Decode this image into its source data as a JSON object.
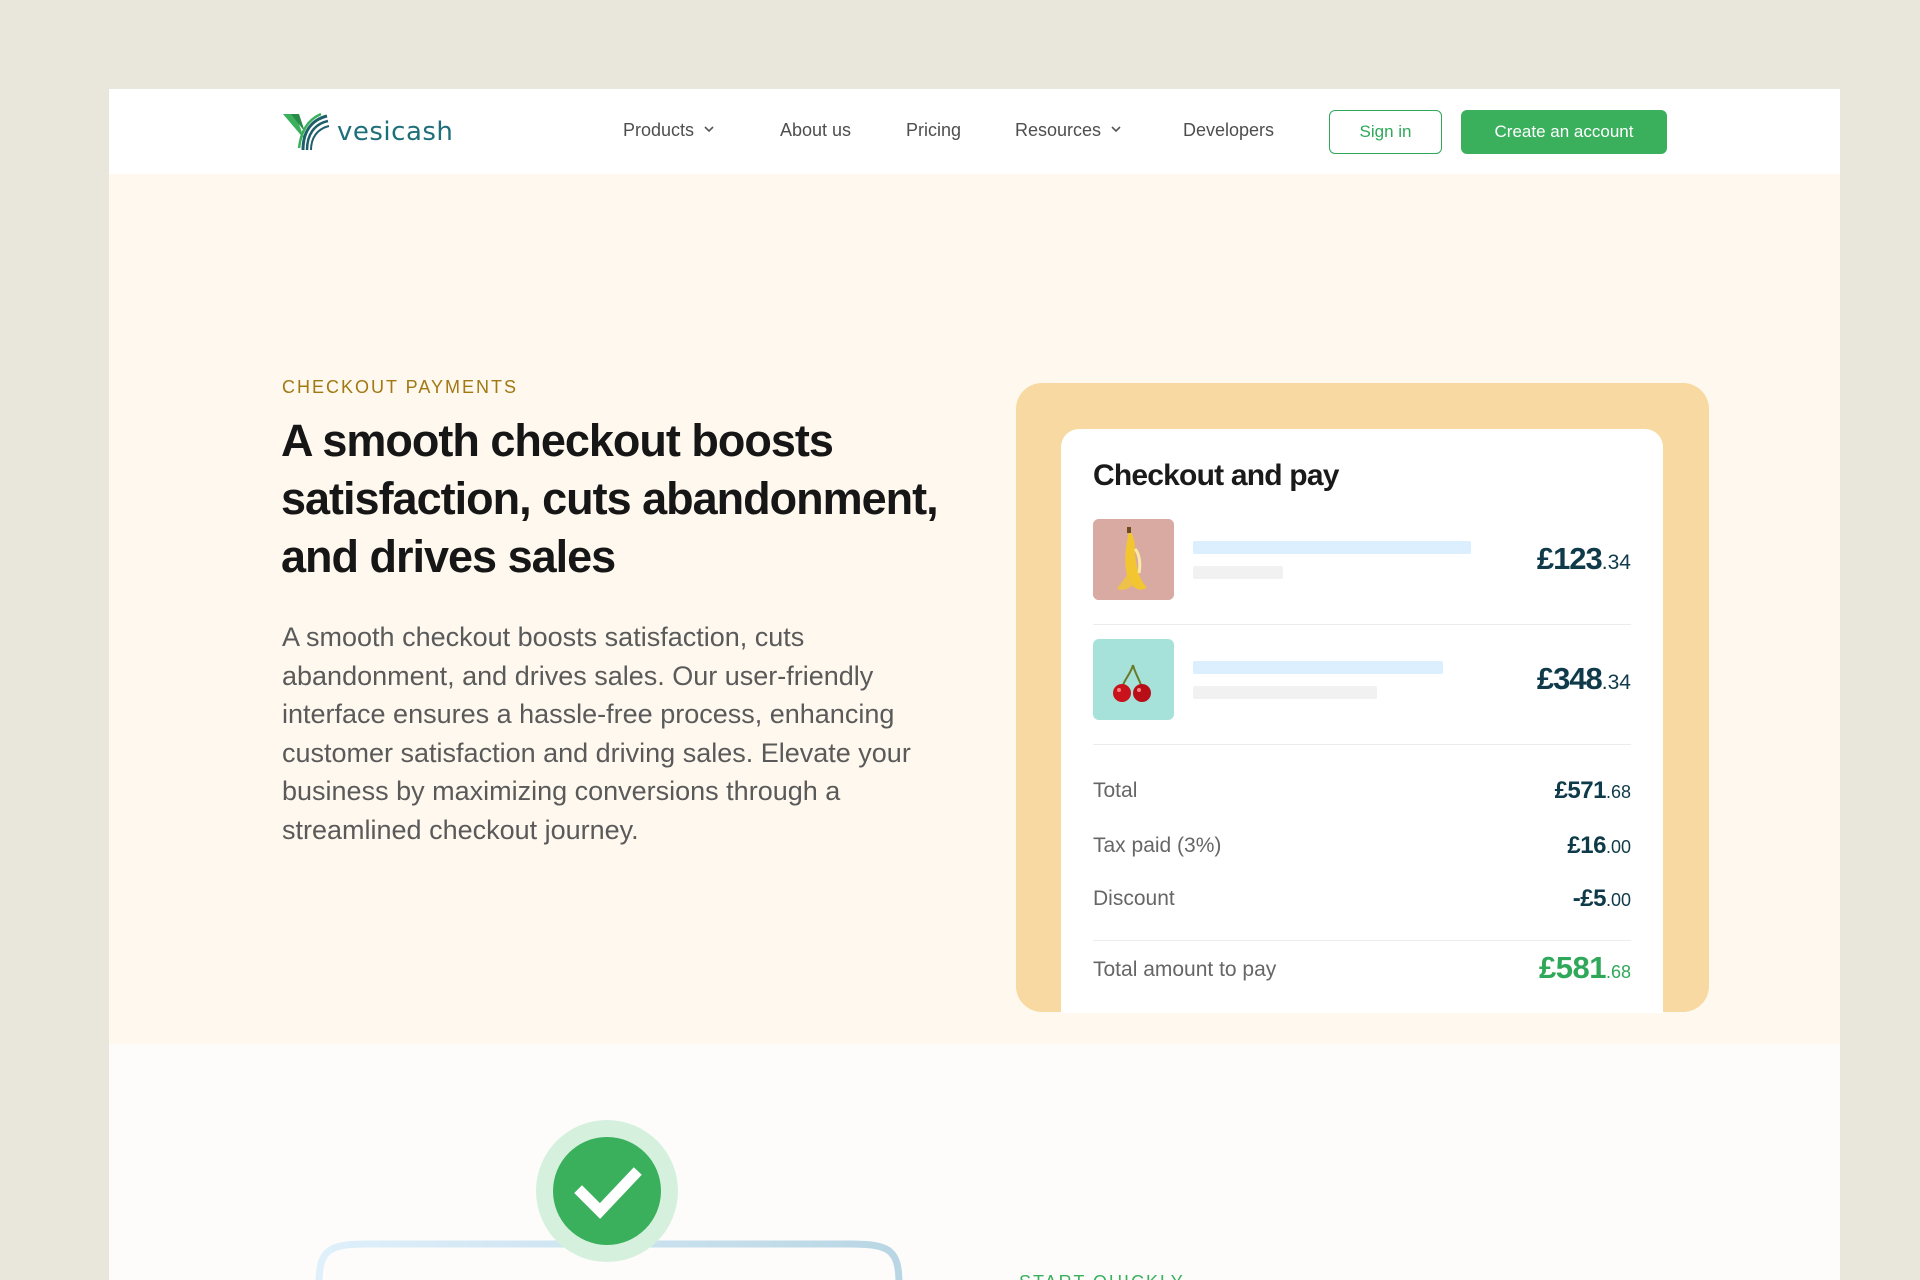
{
  "brand": {
    "name": "vesicash",
    "colors": {
      "green": "#3ab05d",
      "teal": "#1f6f7a",
      "gold": "#a17812",
      "cream": "#fef8ee",
      "tan": "#f7d9a1"
    }
  },
  "nav": {
    "items": [
      {
        "label": "Products",
        "has_dropdown": true
      },
      {
        "label": "About us",
        "has_dropdown": false
      },
      {
        "label": "Pricing",
        "has_dropdown": false
      },
      {
        "label": "Resources",
        "has_dropdown": true
      },
      {
        "label": "Developers",
        "has_dropdown": false
      }
    ],
    "sign_in": "Sign in",
    "create_account": "Create an account"
  },
  "hero": {
    "eyebrow": "CHECKOUT PAYMENTS",
    "headline": "A smooth checkout boosts satisfaction, cuts abandonment, and drives sales",
    "body": "A smooth checkout boosts satisfaction, cuts abandonment, and drives sales. Our user-friendly interface ensures a hassle-free process, enhancing customer satisfaction and driving sales. Elevate your business by maximizing conversions through a streamlined checkout journey."
  },
  "checkout_card": {
    "title": "Checkout and pay",
    "items": [
      {
        "icon": "banana-image",
        "price_major": "£123",
        "price_minor": ".34"
      },
      {
        "icon": "cherry-image",
        "price_major": "£348",
        "price_minor": ".34"
      }
    ],
    "summary": [
      {
        "label": "Total",
        "major": "£571",
        "minor": ".68"
      },
      {
        "label": "Tax paid (3%)",
        "major": "£16",
        "minor": ".00"
      },
      {
        "label": "Discount",
        "major": "-£5",
        "minor": ".00"
      }
    ],
    "grand_total": {
      "label": "Total amount to pay",
      "major": "£581",
      "minor": ".68"
    }
  },
  "lower": {
    "eyebrow": "START QUICKLY",
    "icon": "checkmark-icon"
  }
}
